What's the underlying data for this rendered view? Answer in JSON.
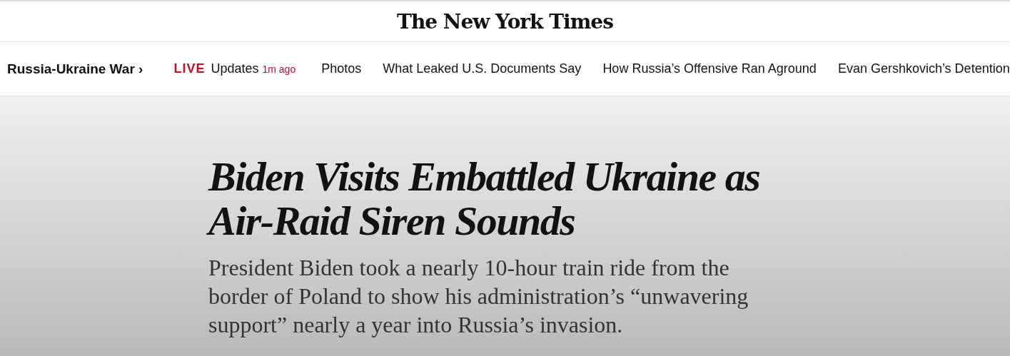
{
  "masthead": {
    "logo": "The New York Times"
  },
  "nav": {
    "section": "Russia-Ukraine War",
    "section_chevron": "›",
    "live_badge": "LIVE",
    "live_label": "Updates",
    "live_time": "1m ago",
    "links": [
      "Photos",
      "What Leaked U.S. Documents Say",
      "How Russia’s Offensive Ran Aground",
      "Evan Gershkovich’s Detention"
    ]
  },
  "hero": {
    "headline": "Biden Visits Embattled Ukraine as Air-Raid Siren Sounds",
    "summary": "President Biden took a nearly 10-hour train ride from the border of Poland to show his administration’s “unwavering support” nearly a year into Russia’s invasion."
  }
}
